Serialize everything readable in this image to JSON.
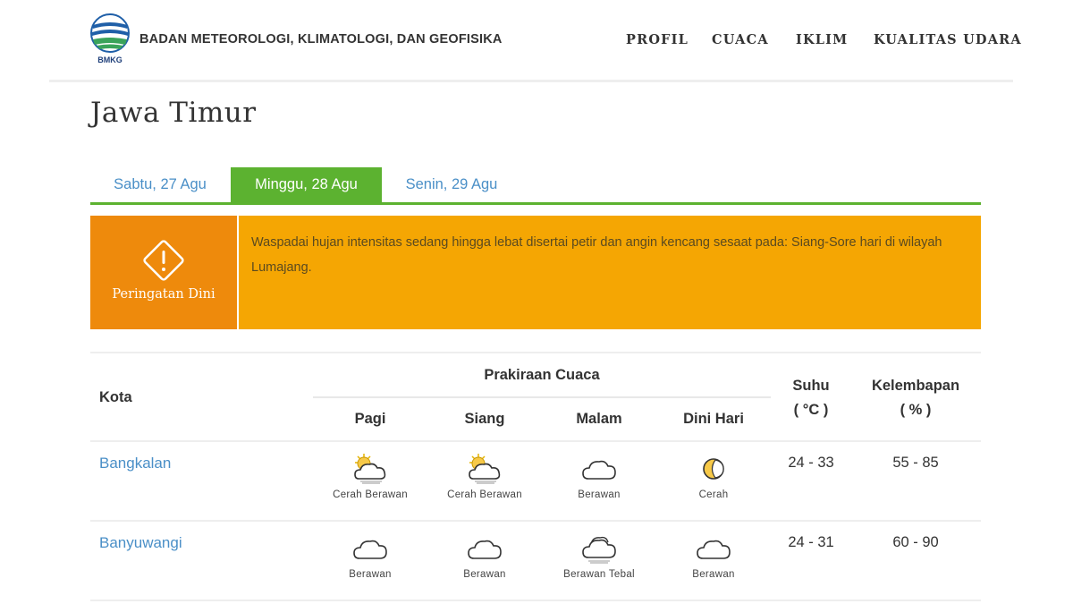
{
  "header": {
    "org_name": "BADAN METEOROLOGI, KLIMATOLOGI, DAN GEOFISIKA",
    "logo_text": "BMKG",
    "nav": [
      "PROFIL",
      "CUACA",
      "IKLIM",
      "KUALITAS UDARA"
    ]
  },
  "page": {
    "title": "Jawa Timur"
  },
  "tabs": [
    {
      "label": "Sabtu, 27 Agu",
      "active": false
    },
    {
      "label": "Minggu, 28 Agu",
      "active": true
    },
    {
      "label": "Senin, 29 Agu",
      "active": false
    }
  ],
  "warning": {
    "label": "Peringatan Dini",
    "text": "Waspadai hujan intensitas sedang hingga lebat disertai petir dan angin kencang sesaat pada: Siang-Sore hari di wilayah Lumajang."
  },
  "table": {
    "col_city": "Kota",
    "col_forecast": "Prakiraan Cuaca",
    "col_temp": "Suhu",
    "col_temp_unit": "( °C )",
    "col_humidity": "Kelembapan",
    "col_humidity_unit": "( % )",
    "periods": [
      "Pagi",
      "Siang",
      "Malam",
      "Dini Hari"
    ],
    "rows": [
      {
        "city": "Bangkalan",
        "forecast": [
          {
            "icon": "partly-cloudy-sun-icon",
            "label": "Cerah Berawan"
          },
          {
            "icon": "partly-cloudy-sun-icon",
            "label": "Cerah Berawan"
          },
          {
            "icon": "cloud-icon",
            "label": "Berawan"
          },
          {
            "icon": "moon-icon",
            "label": "Cerah"
          }
        ],
        "temp": "24 - 33",
        "humidity": "55 - 85"
      },
      {
        "city": "Banyuwangi",
        "forecast": [
          {
            "icon": "cloud-icon",
            "label": "Berawan"
          },
          {
            "icon": "cloud-icon",
            "label": "Berawan"
          },
          {
            "icon": "overcast-cloud-icon",
            "label": "Berawan Tebal"
          },
          {
            "icon": "cloud-icon",
            "label": "Berawan"
          }
        ],
        "temp": "24 - 31",
        "humidity": "60 - 90"
      }
    ]
  },
  "colors": {
    "tab_active": "#5cb230",
    "link": "#4a8fc7",
    "warning_bg": "#f5a603",
    "warning_label_bg": "#ee8a0c"
  }
}
